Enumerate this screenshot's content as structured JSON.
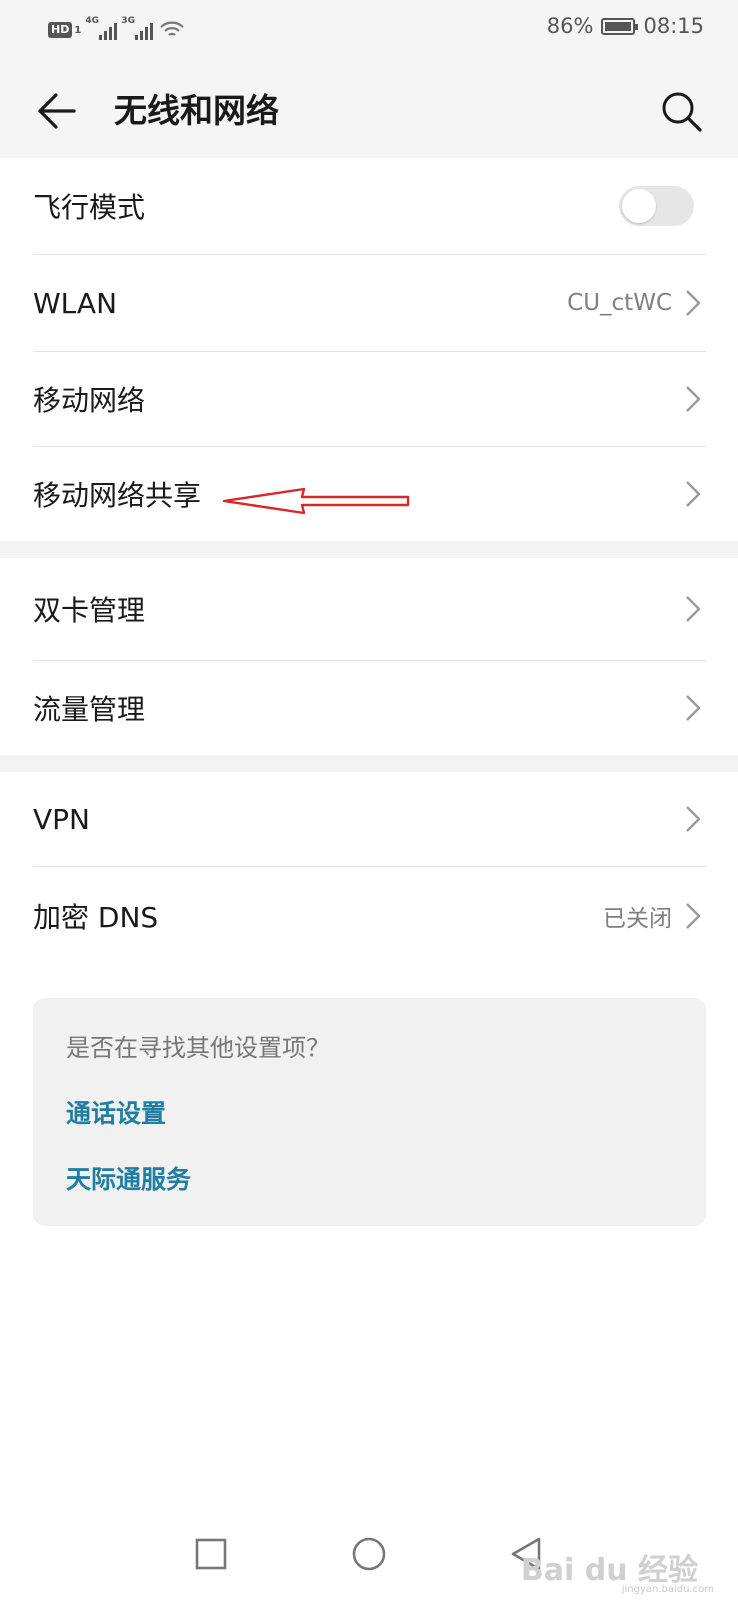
{
  "status_bar": {
    "hd_label": "HD",
    "sim1_network": "4G",
    "sim2_network": "3G",
    "battery": "86%",
    "time": "08:15"
  },
  "app_bar": {
    "title": "无线和网络",
    "back_icon": "back-arrow-icon",
    "search_icon": "search-icon"
  },
  "settings": {
    "airplane_mode": {
      "label": "飞行模式",
      "toggle_on": false
    },
    "wlan": {
      "label": "WLAN",
      "value": "CU_ctWC"
    },
    "mobile_network": {
      "label": "移动网络"
    },
    "tethering": {
      "label": "移动网络共享"
    },
    "dual_sim": {
      "label": "双卡管理"
    },
    "data_usage": {
      "label": "流量管理"
    },
    "vpn": {
      "label": "VPN"
    },
    "private_dns": {
      "label": "加密 DNS",
      "value": "已关闭"
    }
  },
  "suggestions": {
    "question": "是否在寻找其他设置项？",
    "links": [
      "通话设置",
      "天际通服务"
    ]
  },
  "annotation": {
    "color": "#d9262a"
  },
  "watermark": {
    "text": "Bai du 经验",
    "sub": "jingyan.baidu.com"
  },
  "colors": {
    "link": "#1f7ea1",
    "background": "#f5f5f5"
  }
}
